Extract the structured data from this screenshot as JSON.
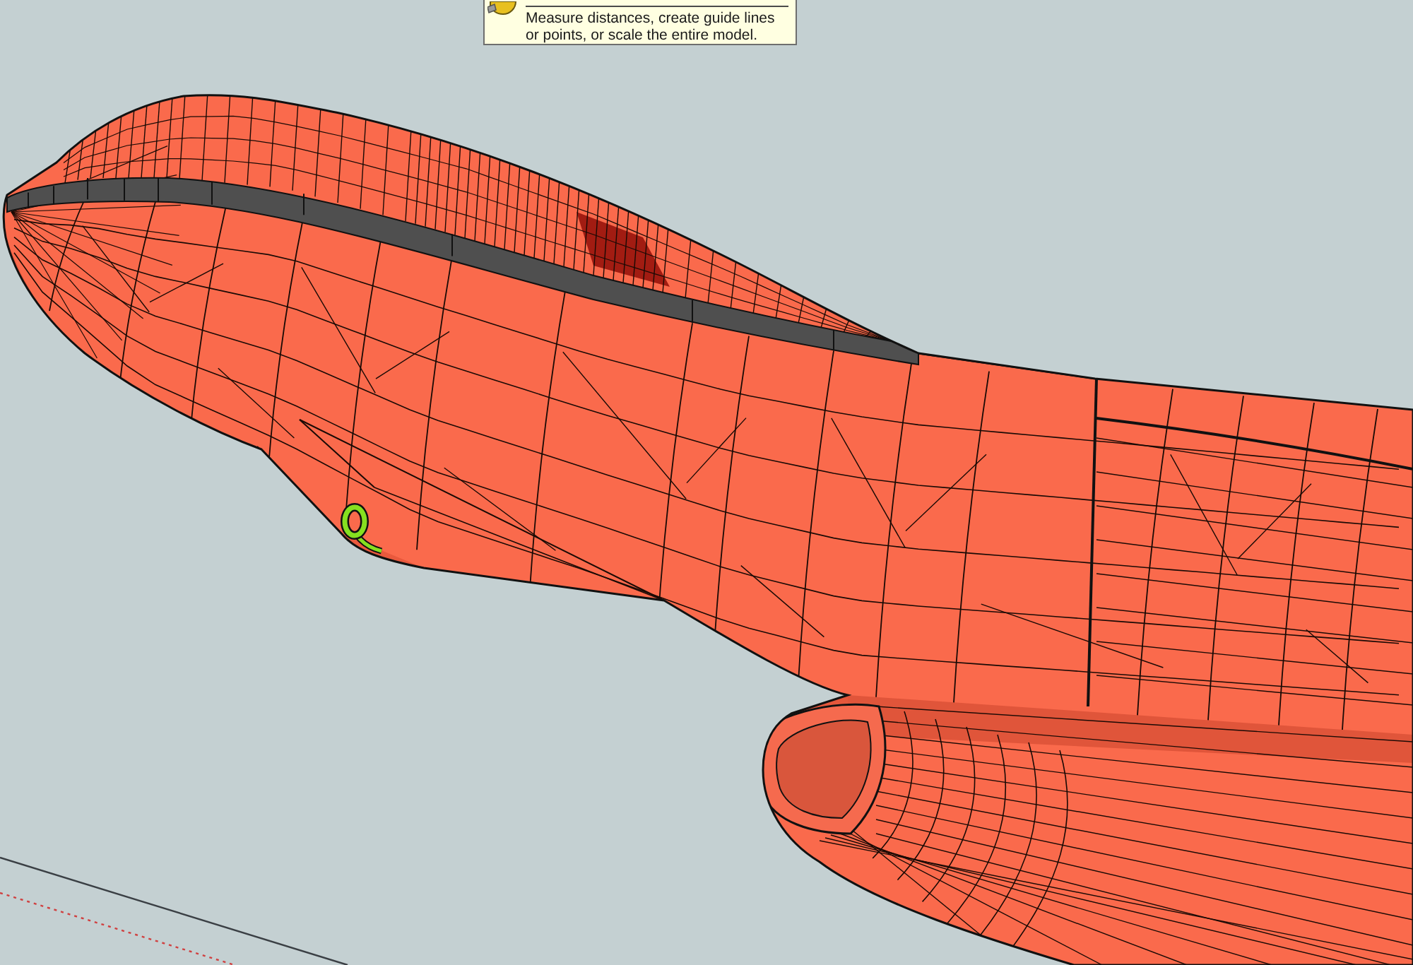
{
  "tooltip": {
    "description": "Measure distances, create guide lines\nor points, or scale the entire model."
  }
}
